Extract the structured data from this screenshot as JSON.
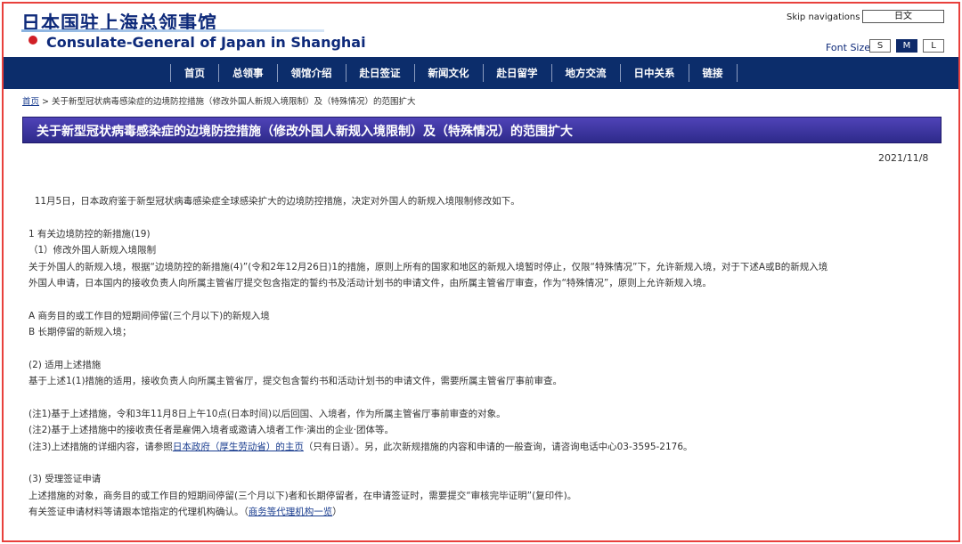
{
  "header": {
    "title_cn": "日本国驻上海总领事馆",
    "title_en": "Consulate-General of Japan in Shanghai",
    "skip_navigations": "Skip navigations",
    "language_button": "日文",
    "font_size_label": "Font Size",
    "font_sizes": [
      "S",
      "M",
      "L"
    ]
  },
  "nav": {
    "items": [
      "首页",
      "总领事",
      "领馆介绍",
      "赴日签证",
      "新闻文化",
      "赴日留学",
      "地方交流",
      "日中关系",
      "链接"
    ]
  },
  "breadcrumb": {
    "home": "首页",
    "separator": ">",
    "current": "关于新型冠状病毒感染症的边境防控措施（修改外国人新规入境限制）及（特殊情况）的范围扩大"
  },
  "page": {
    "title": "关于新型冠状病毒感染症的边境防控措施（修改外国人新规入境限制）及（特殊情况）的范围扩大",
    "date": "2021/11/8"
  },
  "content": {
    "intro": "11月5日，日本政府鉴于新型冠状病毒感染症全球感染扩大的边境防控措施，决定对外国人的新规入境限制修改如下。",
    "section1_title": "1 有关边境防控的新措施(19)",
    "section1_sub": "（1）修改外国人新规入境限制",
    "section1_body1": "关于外国人的新规入境，根据“边境防控的新措施(4)”(令和2年12月26日)1的措施，原则上所有的国家和地区的新规入境暂时停止，仅限“特殊情况”下，允许新规入境，对于下述A或B的新规入境",
    "section1_body2": "外国人申请，日本国内的接收负责人向所属主管省厅提交包含指定的誓约书及活动计划书的申请文件，由所属主管省厅审查，作为“特殊情况”，原则上允许新规入境。",
    "item_a": "A 商务目的或工作目的短期间停留(三个月以下)的新规入境",
    "item_b": "B 长期停留的新规入境；",
    "section2_title": "(2) 适用上述措施",
    "section2_body": "基于上述1(1)措施的适用，接收负责人向所属主管省厅，提交包含誓约书和活动计划书的申请文件，需要所属主管省厅事前审查。",
    "note1": "(注1)基于上述措施，令和3年11月8日上午10点(日本时间)以后回国、入境者，作为所属主管省厅事前审查的对象。",
    "note2": "(注2)基于上述措施中的接收责任者是雇佣入境者或邀请入境者工作·演出的企业·团体等。",
    "note3_before": "(注3)上述措施的详细内容，请参照",
    "note3_link": "日本政府（厚生劳动省）的主页",
    "note3_after": "（只有日语）。另，此次新规措施的内容和申请的一般查询，请咨询电话中心03-3595-2176。",
    "section3_title": "(3) 受理签证申请",
    "section3_body1": "上述措施的对象，商务目的或工作目的短期间停留(三个月以下)者和长期停留者，在申请签证时，需要提交“审核完毕证明”(复印件)。",
    "section3_body2_before": "有关签证申请材料等请跟本馆指定的代理机构确认。（",
    "section3_body2_link": "商务等代理机构一览",
    "section3_body2_after": "）"
  },
  "colors": {
    "accent_border": "#e8403c",
    "nav_background": "#0c2d6b",
    "title_bar": "#3a32a0",
    "brand_text": "#0e2a7a"
  },
  "icons": {
    "flag": "japan-flag-icon"
  }
}
